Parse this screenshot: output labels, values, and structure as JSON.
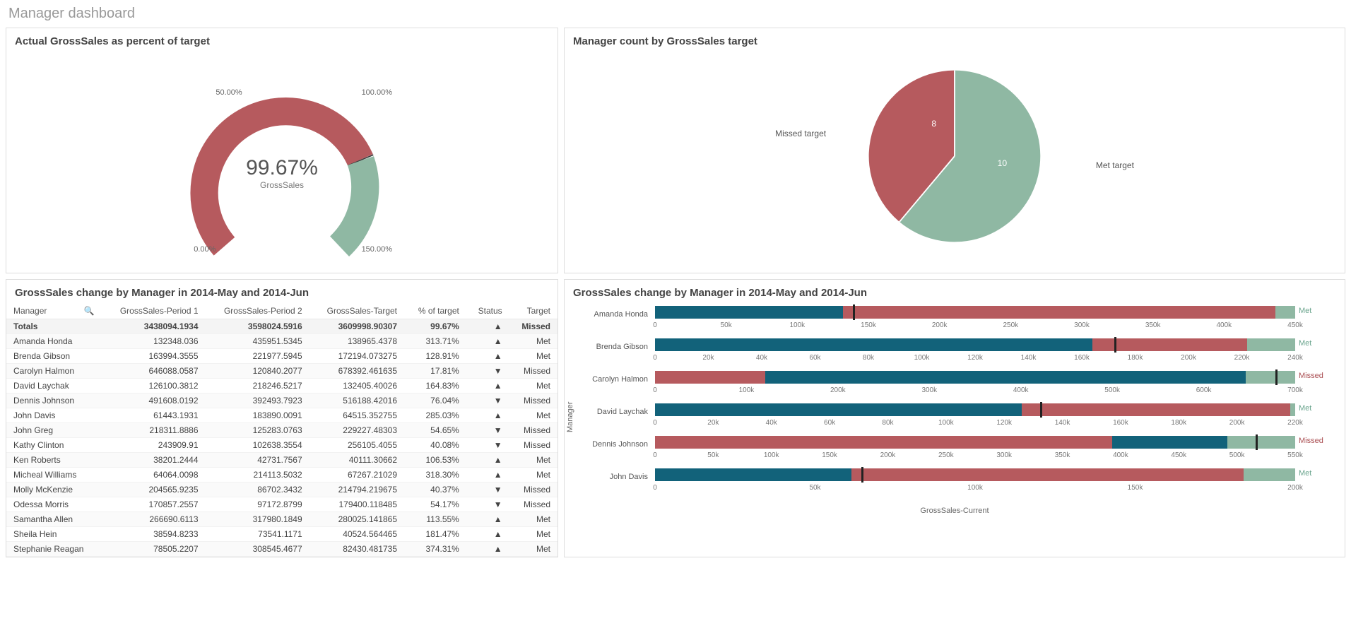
{
  "page_title": "Manager dashboard",
  "colors": {
    "red": "#b65a5e",
    "green": "#8fb8a3",
    "blue": "#12627a",
    "dark": "#3a3a3a"
  },
  "gauge_panel": {
    "title": "Actual GrossSales as percent of target",
    "min_label": "0.00%",
    "mid_label": "50.00%",
    "target_label": "100.00%",
    "max_label": "150.00%",
    "value_text": "99.67%",
    "sublabel": "GrossSales"
  },
  "pie_panel": {
    "title": "Manager count by GrossSales target",
    "missed_label": "Missed target",
    "missed_value": "8",
    "met_label": "Met target",
    "met_value": "10"
  },
  "table_panel": {
    "title": "GrossSales change by Manager in 2014-May and 2014-Jun",
    "headers": [
      "Manager",
      "GrossSales-Period 1",
      "GrossSales-Period 2",
      "GrossSales-Target",
      "% of target",
      "Status",
      "Target"
    ],
    "totals_row": [
      "Totals",
      "3438094.1934",
      "3598024.5916",
      "3609998.90307",
      "99.67%",
      "▲",
      "Missed"
    ],
    "rows": [
      [
        "Amanda Honda",
        "132348.036",
        "435951.5345",
        "138965.4378",
        "313.71%",
        "▲",
        "Met"
      ],
      [
        "Brenda Gibson",
        "163994.3555",
        "221977.5945",
        "172194.073275",
        "128.91%",
        "▲",
        "Met"
      ],
      [
        "Carolyn Halmon",
        "646088.0587",
        "120840.2077",
        "678392.461635",
        "17.81%",
        "▼",
        "Missed"
      ],
      [
        "David Laychak",
        "126100.3812",
        "218246.5217",
        "132405.40026",
        "164.83%",
        "▲",
        "Met"
      ],
      [
        "Dennis Johnson",
        "491608.0192",
        "392493.7923",
        "516188.42016",
        "76.04%",
        "▼",
        "Missed"
      ],
      [
        "John Davis",
        "61443.1931",
        "183890.0091",
        "64515.352755",
        "285.03%",
        "▲",
        "Met"
      ],
      [
        "John Greg",
        "218311.8886",
        "125283.0763",
        "229227.48303",
        "54.65%",
        "▼",
        "Missed"
      ],
      [
        "Kathy Clinton",
        "243909.91",
        "102638.3554",
        "256105.4055",
        "40.08%",
        "▼",
        "Missed"
      ],
      [
        "Ken Roberts",
        "38201.2444",
        "42731.7567",
        "40111.30662",
        "106.53%",
        "▲",
        "Met"
      ],
      [
        "Micheal Williams",
        "64064.0098",
        "214113.5032",
        "67267.21029",
        "318.30%",
        "▲",
        "Met"
      ],
      [
        "Molly McKenzie",
        "204565.9235",
        "86702.3432",
        "214794.219675",
        "40.37%",
        "▼",
        "Missed"
      ],
      [
        "Odessa Morris",
        "170857.2557",
        "97172.8799",
        "179400.118485",
        "54.17%",
        "▼",
        "Missed"
      ],
      [
        "Samantha Allen",
        "266690.6113",
        "317980.1849",
        "280025.141865",
        "113.55%",
        "▲",
        "Met"
      ],
      [
        "Sheila Hein",
        "38594.8233",
        "73541.1171",
        "40524.564465",
        "181.47%",
        "▲",
        "Met"
      ],
      [
        "Stephanie Reagan",
        "78505.2207",
        "308545.4677",
        "82430.481735",
        "374.31%",
        "▲",
        "Met"
      ]
    ]
  },
  "bars_panel": {
    "title": "GrossSales change by Manager in 2014-May and 2014-Jun",
    "ylabel": "Manager",
    "xlabel": "GrossSales-Current",
    "rows": [
      {
        "name": "Amanda Honda",
        "p1": 132348,
        "p2": 435952,
        "target": 138965,
        "max": 450000,
        "ticks": [
          "0",
          "50k",
          "100k",
          "150k",
          "200k",
          "250k",
          "300k",
          "350k",
          "400k",
          "450k"
        ],
        "status": "Met"
      },
      {
        "name": "Brenda Gibson",
        "p1": 163994,
        "p2": 221978,
        "target": 172194,
        "max": 240000,
        "ticks": [
          "0",
          "20k",
          "40k",
          "60k",
          "80k",
          "100k",
          "120k",
          "140k",
          "160k",
          "180k",
          "200k",
          "220k",
          "240k"
        ],
        "status": "Met"
      },
      {
        "name": "Carolyn Halmon",
        "p1": 646088,
        "p2": 120840,
        "target": 678392,
        "max": 700000,
        "ticks": [
          "0",
          "100k",
          "200k",
          "300k",
          "400k",
          "500k",
          "600k",
          "700k"
        ],
        "status": "Missed"
      },
      {
        "name": "David Laychak",
        "p1": 126100,
        "p2": 218247,
        "target": 132405,
        "max": 220000,
        "ticks": [
          "0",
          "20k",
          "40k",
          "60k",
          "80k",
          "100k",
          "120k",
          "140k",
          "160k",
          "180k",
          "200k",
          "220k"
        ],
        "status": "Met"
      },
      {
        "name": "Dennis Johnson",
        "p1": 491608,
        "p2": 392494,
        "target": 516188,
        "max": 550000,
        "ticks": [
          "0",
          "50k",
          "100k",
          "150k",
          "200k",
          "250k",
          "300k",
          "350k",
          "400k",
          "450k",
          "500k",
          "550k"
        ],
        "status": "Missed"
      },
      {
        "name": "John Davis",
        "p1": 61443,
        "p2": 183890,
        "target": 64515,
        "max": 200000,
        "ticks": [
          "0",
          "50k",
          "100k",
          "150k",
          "200k"
        ],
        "status": "Met"
      }
    ]
  },
  "chart_data": [
    {
      "type": "gauge",
      "title": "Actual GrossSales as percent of target",
      "value": 99.67,
      "min": 0,
      "max": 150,
      "target": 100,
      "unit": "%",
      "label": "GrossSales",
      "segments": [
        {
          "from": 0,
          "to": 99.67,
          "color": "#b65a5e"
        },
        {
          "from": 99.67,
          "to": 100,
          "color": "#3a3a3a"
        },
        {
          "from": 100,
          "to": 150,
          "color": "#8fb8a3"
        }
      ]
    },
    {
      "type": "pie",
      "title": "Manager count by GrossSales target",
      "series": [
        {
          "name": "Missed target",
          "value": 8,
          "color": "#b65a5e"
        },
        {
          "name": "Met target",
          "value": 10,
          "color": "#8fb8a3"
        }
      ]
    },
    {
      "type": "table",
      "title": "GrossSales change by Manager in 2014-May and 2014-Jun",
      "columns": [
        "Manager",
        "GrossSales-Period 1",
        "GrossSales-Period 2",
        "GrossSales-Target",
        "% of target",
        "Status",
        "Target"
      ],
      "rows": [
        [
          "Amanda Honda",
          132348.036,
          435951.5345,
          138965.4378,
          313.71,
          "up",
          "Met"
        ],
        [
          "Brenda Gibson",
          163994.3555,
          221977.5945,
          172194.073275,
          128.91,
          "up",
          "Met"
        ],
        [
          "Carolyn Halmon",
          646088.0587,
          120840.2077,
          678392.461635,
          17.81,
          "down",
          "Missed"
        ],
        [
          "David Laychak",
          126100.3812,
          218246.5217,
          132405.40026,
          164.83,
          "up",
          "Met"
        ],
        [
          "Dennis Johnson",
          491608.0192,
          392493.7923,
          516188.42016,
          76.04,
          "down",
          "Missed"
        ],
        [
          "John Davis",
          61443.1931,
          183890.0091,
          64515.352755,
          285.03,
          "up",
          "Met"
        ],
        [
          "John Greg",
          218311.8886,
          125283.0763,
          229227.48303,
          54.65,
          "down",
          "Missed"
        ],
        [
          "Kathy Clinton",
          243909.91,
          102638.3554,
          256105.4055,
          40.08,
          "down",
          "Missed"
        ],
        [
          "Ken Roberts",
          38201.2444,
          42731.7567,
          40111.30662,
          106.53,
          "up",
          "Met"
        ],
        [
          "Micheal Williams",
          64064.0098,
          214113.5032,
          67267.21029,
          318.3,
          "up",
          "Met"
        ],
        [
          "Molly McKenzie",
          204565.9235,
          86702.3432,
          214794.219675,
          40.37,
          "down",
          "Missed"
        ],
        [
          "Odessa Morris",
          170857.2557,
          97172.8799,
          179400.118485,
          54.17,
          "down",
          "Missed"
        ],
        [
          "Samantha Allen",
          266690.6113,
          317980.1849,
          280025.141865,
          113.55,
          "up",
          "Met"
        ],
        [
          "Sheila Hein",
          38594.8233,
          73541.1171,
          40524.564465,
          181.47,
          "up",
          "Met"
        ],
        [
          "Stephanie Reagan",
          78505.2207,
          308545.4677,
          82430.481735,
          374.31,
          "up",
          "Met"
        ]
      ],
      "totals": [
        "Totals",
        3438094.1934,
        3598024.5916,
        3609998.90307,
        99.67,
        "up",
        "Missed"
      ]
    },
    {
      "type": "bar",
      "title": "GrossSales change by Manager in 2014-May and 2014-Jun",
      "xlabel": "GrossSales-Current",
      "ylabel": "Manager",
      "orientation": "horizontal",
      "categories": [
        "Amanda Honda",
        "Brenda Gibson",
        "Carolyn Halmon",
        "David Laychak",
        "Dennis Johnson",
        "John Davis"
      ],
      "series": [
        {
          "name": "Period 1",
          "color": "#12627a",
          "values": [
            132348,
            163994,
            646088,
            126100,
            491608,
            61443
          ]
        },
        {
          "name": "Period 2",
          "color": "#b65a5e",
          "values": [
            435952,
            221978,
            120840,
            218247,
            392494,
            183890
          ]
        },
        {
          "name": "Target",
          "color": "#222",
          "values": [
            138965,
            172194,
            678392,
            132405,
            516188,
            64515
          ],
          "style": "tick"
        }
      ],
      "per_category_xmax": [
        450000,
        240000,
        700000,
        220000,
        550000,
        200000
      ],
      "status": [
        "Met",
        "Met",
        "Missed",
        "Met",
        "Missed",
        "Met"
      ]
    }
  ]
}
